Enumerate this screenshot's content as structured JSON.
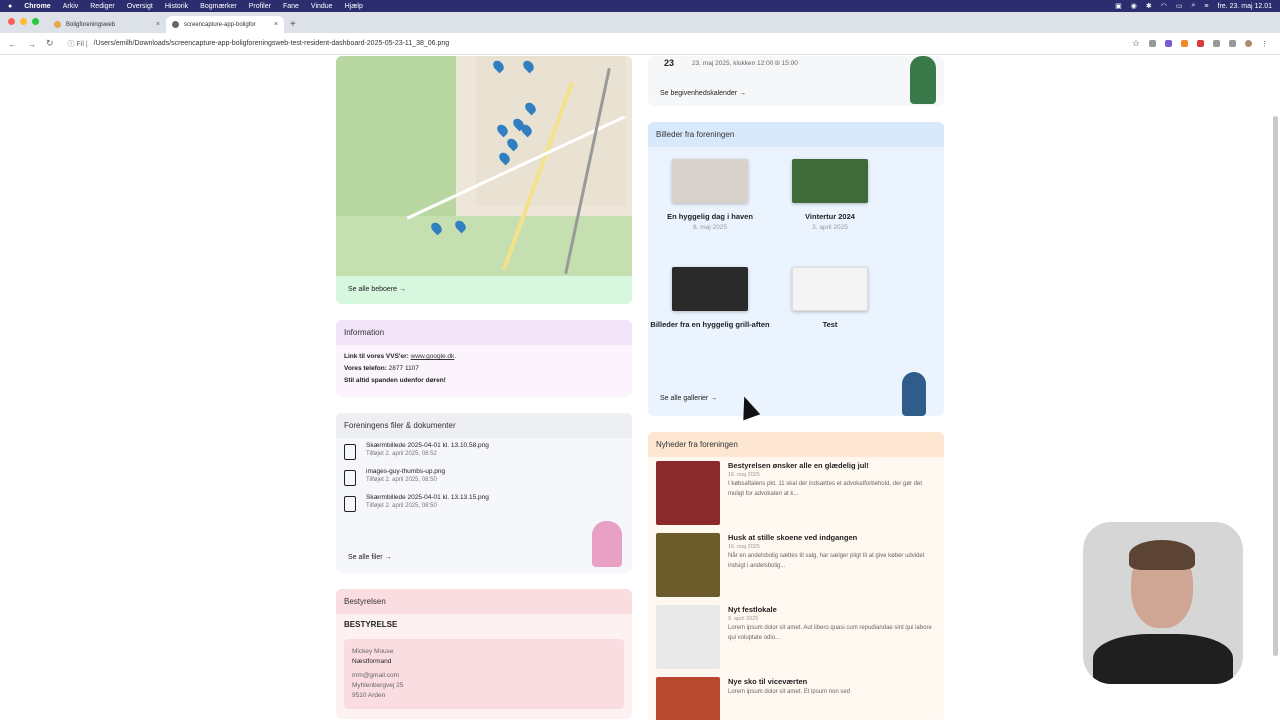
{
  "menubar": {
    "app": "Chrome",
    "items": [
      "Arkiv",
      "Rediger",
      "Oversigt",
      "Historik",
      "Bogmærker",
      "Profiler",
      "Fane",
      "Vindue",
      "Hjælp"
    ],
    "clock": "fre. 23. maj 12.01"
  },
  "tabs": [
    {
      "label": "Boligforeningsweb"
    },
    {
      "label": "screencapture-app-boligfor"
    }
  ],
  "address": {
    "scheme": "Fil",
    "url": "/Users/emilh/Downloads/screencapture-app-boligforeningsweb-test-resident-dashboard-2025-05-23-11_38_06.png"
  },
  "map_card": {
    "see_all": "Se alle beboere →"
  },
  "info_card": {
    "title": "Information",
    "line1_label": "Link til vores VVS'er:",
    "line1_link": "www.google.dk",
    "line1_end": ".",
    "line2_label": "Vores telefon:",
    "line2_value": "2877 1107",
    "line3": "Stil altid spanden udenfor døren!"
  },
  "files_card": {
    "title": "Foreningens filer & dokumenter",
    "files": [
      {
        "name": "Skærmbillede 2025-04-01 kl. 13.10.58.png",
        "date": "Tilføjet 2. april 2025, 08:52"
      },
      {
        "name": "images-guy-thumbs-up.png",
        "date": "Tilføjet 2. april 2025, 08:50"
      },
      {
        "name": "Skærmbillede 2025-04-01 kl. 13.13.15.png",
        "date": "Tilføjet 2. april 2025, 08:50"
      }
    ],
    "see_all": "Se alle filer →"
  },
  "board_card": {
    "title": "Bestyrelsen",
    "subtitle": "BESTYRELSE",
    "member": {
      "name": "Mickey Mouse",
      "role": "Næstformand",
      "email": "mm@gmail.com",
      "street": "Myhlenbergvej 25",
      "city": "9510 Arden"
    }
  },
  "events_card": {
    "day": "23",
    "text": "23. maj 2025, klokken 12:00 til 15:00",
    "see_all": "Se begivenhedskalender →"
  },
  "gallery_card": {
    "title": "Billeder fra foreningen",
    "items": [
      {
        "title": "En hyggelig dag i haven",
        "date": "8. maj 2025"
      },
      {
        "title": "Vintertur 2024",
        "date": "3. april 2025"
      },
      {
        "title": "Billeder fra en hyggelig grill-aften",
        "date": ""
      },
      {
        "title": "Test",
        "date": ""
      }
    ],
    "see_all": "Se alle gallerier →"
  },
  "news_card": {
    "title": "Nyheder fra foreningen",
    "items": [
      {
        "title": "Bestyrelsen ønsker alle en glædelig jul!",
        "date": "16. maj 2025",
        "excerpt": "I købsaftalens pkt. 11 skal der indsættes et advokatforbehold, der gør det muligt for advokaten at k..."
      },
      {
        "title": "Husk at stille skoene ved indgangen",
        "date": "16. maj 2025",
        "excerpt": "Når en andelsbolig sættes til salg, har sælger pligt til at give køber udvidet indsigt i andelsbolig..."
      },
      {
        "title": "Nyt festlokale",
        "date": "9. april 2025",
        "excerpt": "Lorem ipsum dolor sit amet. Aut libero quasi cum repudiandae sint qui labore qui voluptate odio..."
      },
      {
        "title": "Nye sko til viceværten",
        "date": "",
        "excerpt": "Lorem ipsum dolor sit amet. Et ipsum non sed"
      }
    ]
  },
  "colors": {
    "menubar": "#2b2d6e",
    "map_footer": "#d8f7df",
    "info_head": "#f1e3f8",
    "gallery_head": "#d9e9fc",
    "news_head": "#fde6d2",
    "board_head": "#fadde1"
  }
}
